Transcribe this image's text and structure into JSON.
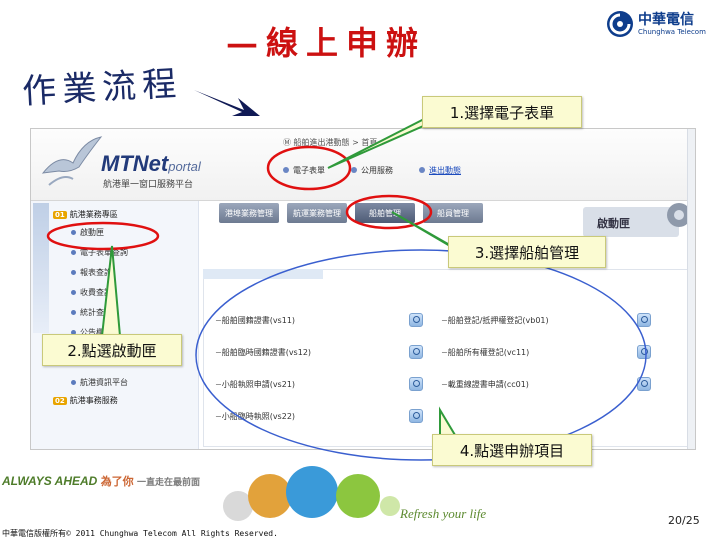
{
  "title": {
    "handwritten": "作業流程",
    "dash": "—",
    "main": "線上申辦"
  },
  "logo": {
    "name_cn": "中華電信",
    "name_en": "Chunghwa Telecom"
  },
  "screenshot": {
    "portal_logo": "MTNet",
    "portal_logo_suffix": "portal",
    "portal_subtitle": "航港單一窗口服務平台",
    "crumb": "Ⓜ 船舶進出港動態 > 首頁",
    "header_menu": [
      {
        "label": "電子表單",
        "highlight": false
      },
      {
        "label": "公用服務",
        "highlight": false
      },
      {
        "label": "進出動態",
        "highlight": true
      }
    ],
    "sidebar": {
      "group1": {
        "num": "01",
        "label": "航港業務專區"
      },
      "items": [
        "啟動匣",
        "電子表單查詢",
        "報表查詢",
        "收費查詢",
        "統計查詢",
        "公告欄"
      ],
      "item_extra": "航港資訊平台",
      "group2": {
        "num": "02",
        "label": "航港事務服務"
      }
    },
    "tabs": [
      "港埠業務管理",
      "航運業務管理",
      "船舶管理",
      "船員管理"
    ],
    "gear_label": "啟動匣",
    "services_left": [
      "船舶國籍證書(vs11)",
      "船舶臨時國籍證書(vs12)",
      "小船執照申請(vs21)",
      "小船臨時執照(vs22)"
    ],
    "services_right": [
      "船舶登記/抵押權登記(vb01)",
      "船舶所有權登記(vc11)",
      "載重線證書申請(cc01)"
    ]
  },
  "callouts": {
    "step1": "1.選擇電子表單",
    "step2": "2.點選啟動匣",
    "step3": "3.選擇船舶管理",
    "step4": "4.點選申辦項目"
  },
  "footer": {
    "always_ahead": "ALWAYS AHEAD",
    "slogan_cn": "為了你",
    "slogan_cn2": "一直走在最前面",
    "refresh": "Refresh your life",
    "page": "20/25",
    "copyright": "中華電信版權所有© 2011 Chunghwa Telecom All Rights Reserved."
  },
  "colors": {
    "title_red": "#cc1111",
    "callout_fill": "#fbfbd2",
    "highlight_circle": "#e01010",
    "arrow_green": "#2f9a3a"
  }
}
